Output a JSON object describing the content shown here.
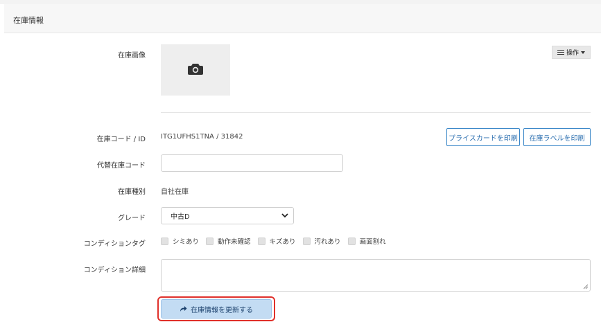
{
  "panel": {
    "title": "在庫情報"
  },
  "operations": {
    "label": "操作"
  },
  "fields": {
    "image_label": "在庫画像",
    "code_label": "在庫コード / ID",
    "code_value": "ITG1UFHS1TNA / 31842",
    "alt_code_label": "代替在庫コード",
    "alt_code_value": "",
    "type_label": "在庫種別",
    "type_value": "自社在庫",
    "grade_label": "グレード",
    "grade_value": "中古D",
    "condition_tag_label": "コンディションタグ",
    "condition_detail_label": "コンディション詳細",
    "condition_detail_value": ""
  },
  "buttons": {
    "print_price_card": "プライスカードを印刷",
    "print_stock_label": "在庫ラベルを印刷",
    "update": "在庫情報を更新する"
  },
  "condition_tags": [
    {
      "label": "シミあり",
      "checked": false
    },
    {
      "label": "動作未確認",
      "checked": false
    },
    {
      "label": "キズあり",
      "checked": false
    },
    {
      "label": "汚れあり",
      "checked": false
    },
    {
      "label": "画面割れ",
      "checked": false
    }
  ],
  "colors": {
    "accent": "#3a87c8",
    "primary_button_bg": "#c3dcf3",
    "highlight": "#e0302a"
  },
  "icons": {
    "camera": "camera-icon",
    "operations": "list-icon",
    "grade_select": "chevron-down-icon",
    "update": "share-icon"
  }
}
